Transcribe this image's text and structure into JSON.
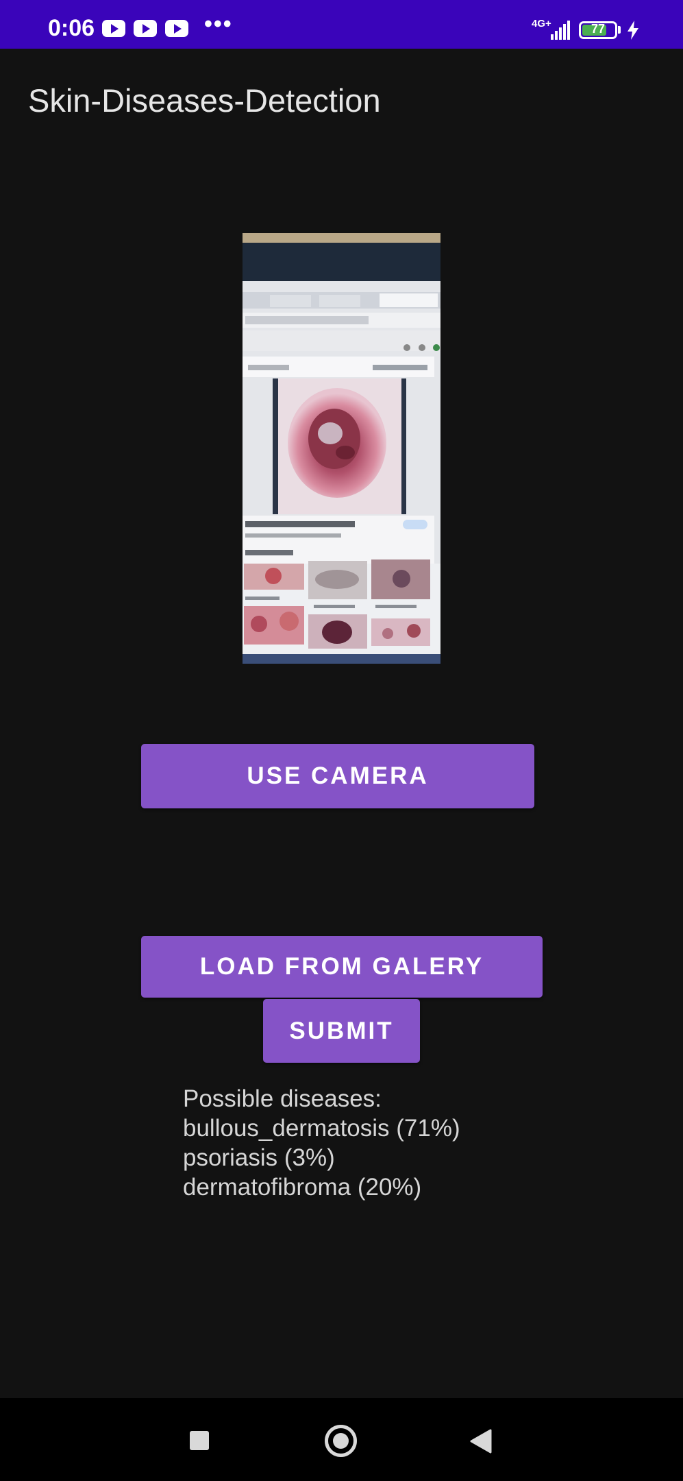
{
  "status_bar": {
    "time": "0:06",
    "notification_icons": [
      "youtube-icon",
      "youtube-icon",
      "youtube-icon"
    ],
    "more_indicator": "•••",
    "network_label": "4G+",
    "battery_level": "77",
    "battery_fraction": 0.77,
    "charging": true,
    "background_color": "#3a04ba"
  },
  "app": {
    "title": "Skin-Diseases-Detection"
  },
  "preview": {
    "icon": "photo-preview"
  },
  "buttons": {
    "camera": "USE CAMERA",
    "gallery": "LOAD FROM GALERY",
    "submit": "SUBMIT",
    "color": "#8553c7"
  },
  "results": {
    "heading": "Possible diseases:",
    "lines": [
      "bullous_dermatosis (71%)",
      "psoriasis (3%)",
      "dermatofibroma (20%)"
    ]
  },
  "nav_bar": {
    "icons": [
      "recent-apps-icon",
      "home-icon",
      "back-icon"
    ]
  }
}
